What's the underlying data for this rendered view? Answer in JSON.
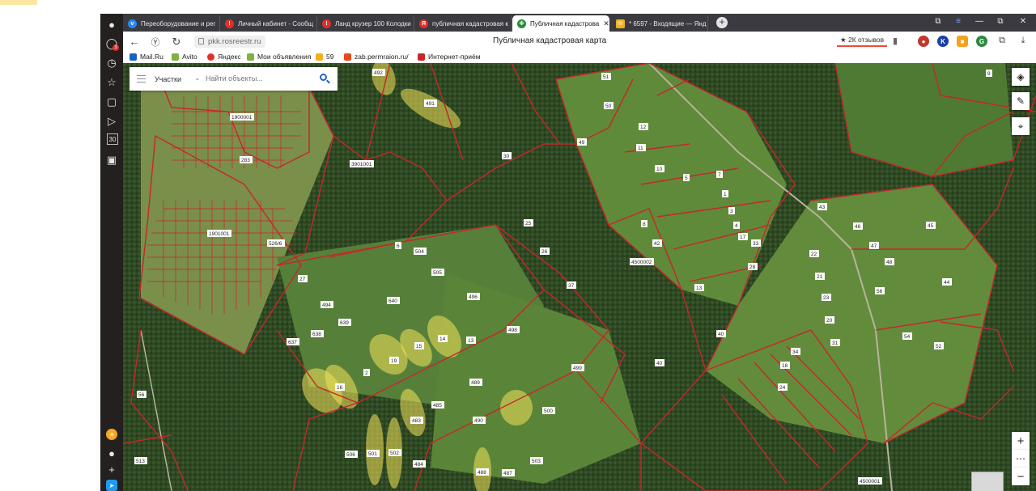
{
  "browser": {
    "tabs": [
      {
        "label": "Переоборудование и рег",
        "icon": "vk-icon",
        "color": "#2787f5"
      },
      {
        "label": "Личный кабинет - Сообщ",
        "icon": "avito-icon",
        "color": "#e0302a"
      },
      {
        "label": "Ланд крузер 100 Колодки",
        "icon": "avito-icon",
        "color": "#e0302a"
      },
      {
        "label": "публичная кадастровая к",
        "icon": "yandex-icon",
        "color": "#e0302a"
      },
      {
        "label": "Публичная кадастрова",
        "icon": "rosreestr-icon",
        "color": "#2b8a3e",
        "active": true
      },
      {
        "label": "* 6597 - Входящие — Янд",
        "icon": "mail-icon",
        "color": "#f2b01e"
      }
    ],
    "new_tab": "+",
    "window_buttons": [
      "⧉",
      "≡",
      "—",
      "⧉",
      "✕"
    ],
    "url": "pkk.rosreestr.ru",
    "page_title": "Публичная кадастровая карта",
    "reviews_badge": "★ 2К отзывов",
    "bookmarks": [
      {
        "label": "Mail.Ru",
        "color": "#1565c0"
      },
      {
        "label": "Avito",
        "color": "#7cb342"
      },
      {
        "label": "Яндекс",
        "color": "#e0302a"
      },
      {
        "label": "Мои объявления",
        "color": "#7cb342"
      },
      {
        "label": "59",
        "color": "#f2b01e"
      },
      {
        "label": "zab.permraion.ru/",
        "color": "#e64a19"
      },
      {
        "label": "Интернет-приём",
        "color": "#c62828"
      }
    ],
    "sidebar_notification_count": "3",
    "sidebar_item_30": "30"
  },
  "map": {
    "search": {
      "type_label": "Участки",
      "placeholder": "Найти объекты..."
    },
    "controls": {
      "layers": "layers-icon",
      "ruler": "ruler-icon",
      "locate": "locate-icon",
      "zoom_in": "+",
      "more": "⋯",
      "zoom_out": "−"
    },
    "colors": {
      "parcel_border": "#c8262a",
      "highlight": "#f4e15a",
      "forest": "#2f4824",
      "field": "#5f8a3a"
    },
    "labels": {
      "quarter_1": "1900001",
      "quarter_2": "3901001",
      "quarter_3": "1901001",
      "quarter_4": "4500002",
      "quarter_5": "4500001",
      "p492": "492",
      "p491": "491",
      "p51": "51",
      "p50": "50",
      "p9": "9",
      "p49": "49",
      "p12": "12",
      "p11": "11",
      "p10": "10",
      "p5": "5",
      "p7": "7",
      "p1": "1",
      "p3": "3",
      "p4": "4",
      "p8": "8",
      "p42": "42",
      "p33": "33",
      "p28": "28",
      "p17": "17",
      "p13": "13",
      "p25": "25",
      "p26": "26",
      "p37": "37",
      "p30": "30",
      "p6": "6",
      "p504": "504",
      "p505": "505",
      "p27": "27",
      "p494": "494",
      "p498": "498",
      "p499": "499",
      "p496": "496",
      "p13b": "13",
      "p489": "489",
      "p490": "490",
      "p500": "500",
      "p485": "485",
      "p483": "483",
      "p503": "503",
      "p484": "484",
      "p488": "488",
      "p487": "487",
      "p506": "506",
      "p501": "501",
      "p502": "502",
      "p56": "56",
      "p513": "513",
      "p43": "43",
      "p46": "46",
      "p45": "45",
      "p47": "47",
      "p48": "48",
      "p22": "22",
      "p21": "21",
      "p23": "23",
      "p20": "20",
      "p31": "31",
      "p34": "34",
      "p18": "18",
      "p24": "24",
      "p40": "40",
      "p44": "44",
      "p54": "54",
      "p52": "52",
      "p526": "526/6",
      "p638": "638",
      "p637": "637",
      "p639": "639",
      "p640": "640",
      "p283": "283",
      "p2": "2",
      "p19": "19",
      "p14": "14",
      "p15": "15",
      "p16": "16"
    }
  }
}
